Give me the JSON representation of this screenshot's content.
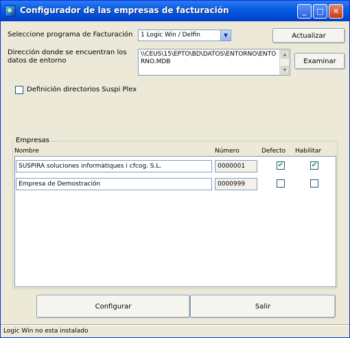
{
  "window": {
    "title": "Configurador de las empresas de facturación"
  },
  "form": {
    "program_label": "Seleccione programa de Facturación",
    "program_selected": "1 Logic Win / Delfin",
    "update_button": "Actualizar",
    "dir_label": "Dirección donde se encuentran los datos de entorno",
    "dir_value": "\\\\CEUS\\15\\EPTO\\BD\\DATOS\\ENTORNO\\ENTORNO.MDB",
    "browse_button": "Examinar",
    "suspira_dir_label": "Definición directorios Suspi Plex",
    "suspira_dir_checked": false
  },
  "companies": {
    "group_label": "Empresas",
    "headers": {
      "name": "Nombre",
      "number": "Número",
      "default": "Defecto",
      "enable": "Habilitar"
    },
    "rows": [
      {
        "name": "SUSPIRA soluciones informàtiques i cfcog. S.L.",
        "number": "0000001",
        "default": true,
        "enabled": true
      },
      {
        "name": "Empresa de Demostración",
        "number": "0000999",
        "default": false,
        "enabled": false
      }
    ]
  },
  "footer": {
    "configure_button": "Configurar",
    "exit_button": "Salir"
  },
  "status": {
    "text": "Logic Win no esta instalado"
  },
  "icons": {
    "check": "✔"
  }
}
